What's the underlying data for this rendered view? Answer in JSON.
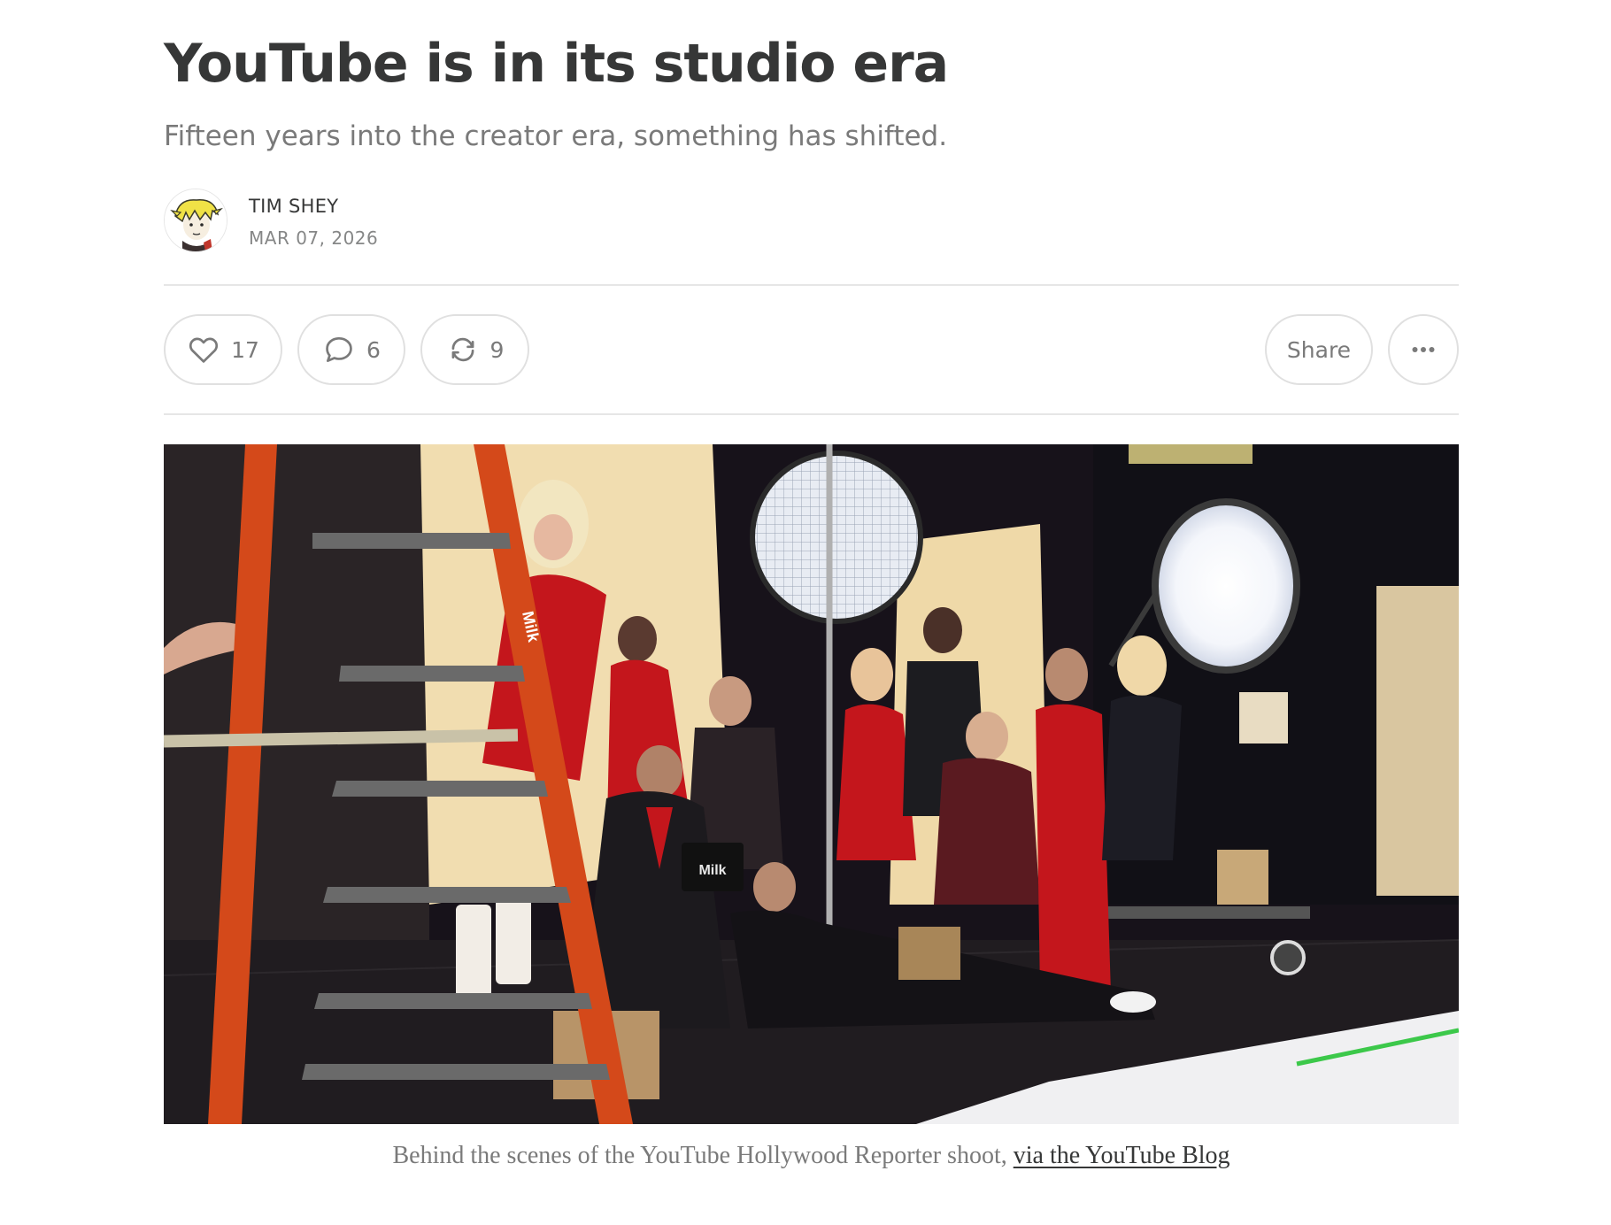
{
  "post": {
    "title": "YouTube is in its studio era",
    "subtitle": "Fifteen years into the creator era, something has shifted.",
    "author": "TIM SHEY",
    "date": "MAR 07, 2026"
  },
  "actions": {
    "like_count": "17",
    "comment_count": "6",
    "restack_count": "9",
    "share_label": "Share",
    "like_icon": "heart-icon",
    "comment_icon": "speech-bubble-icon",
    "restack_icon": "restack-arrows-icon",
    "more_icon": "ellipsis-icon"
  },
  "figure": {
    "caption_text": "Behind the scenes of the YouTube Hollywood Reporter shoot, ",
    "caption_link": "via the YouTube Blog",
    "ladder_brand": "Milk",
    "box_brand": "Milk"
  },
  "colors": {
    "text": "#363737",
    "muted": "#7a7a7a",
    "divider": "#e6e6e6",
    "ladder": "#d4491a"
  }
}
